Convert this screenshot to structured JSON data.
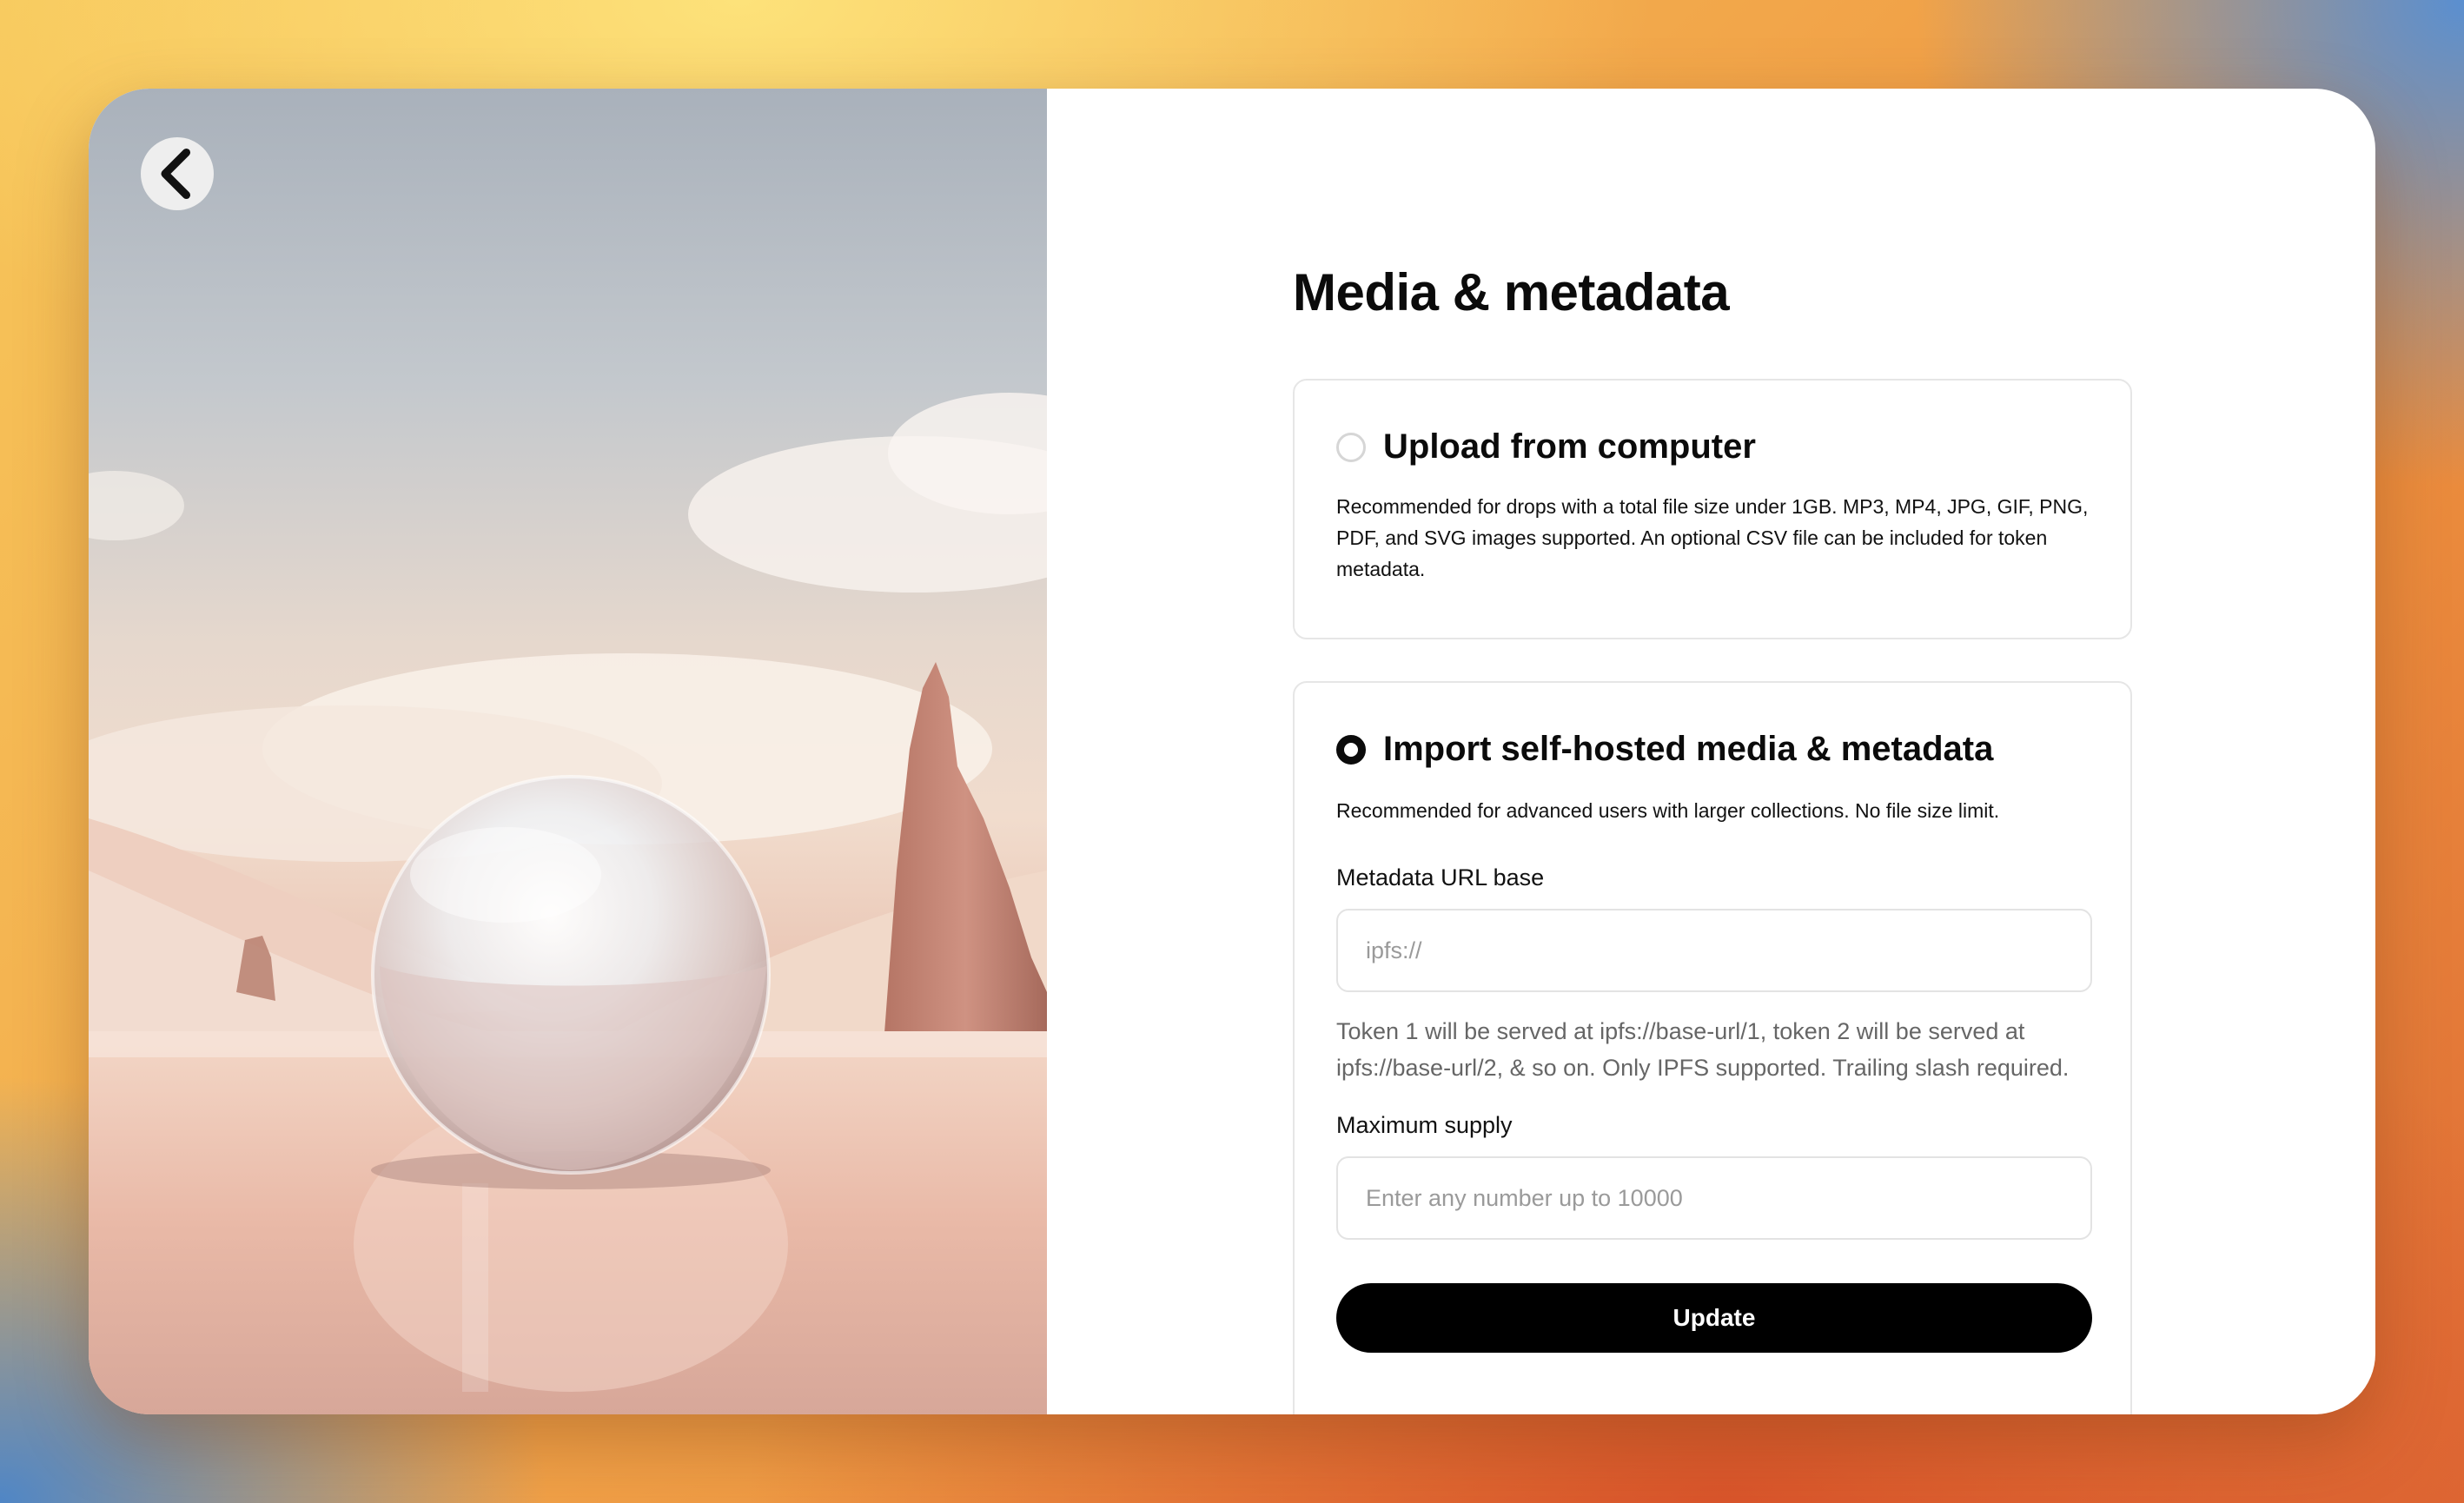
{
  "nav": {
    "back_icon": "chevron-left-icon"
  },
  "page": {
    "title": "Media & metadata"
  },
  "options": [
    {
      "title": "Upload from computer",
      "selected": false,
      "description": "Recommended for drops with a total file size under 1GB. MP3, MP4, JPG, GIF, PNG, PDF, and SVG images supported. An optional CSV file can be included for token metadata."
    },
    {
      "title": "Import self-hosted media & metadata",
      "selected": true,
      "description": "Recommended for advanced users with larger collections. No file size limit."
    }
  ],
  "form": {
    "metadata_url": {
      "label": "Metadata URL base",
      "placeholder": "ipfs://",
      "value": "",
      "help": "Token 1 will be served at ipfs://base-url/1, token 2 will be served at ipfs://base-url/2, & so on. Only IPFS supported. Trailing slash required."
    },
    "max_supply": {
      "label": "Maximum supply",
      "placeholder": "Enter any number up to 10000",
      "value": ""
    },
    "submit_label": "Update"
  },
  "colors": {
    "primary": "#000000",
    "card_bg": "#ffffff",
    "border": "#e6e6e6",
    "muted_text": "#666666"
  }
}
